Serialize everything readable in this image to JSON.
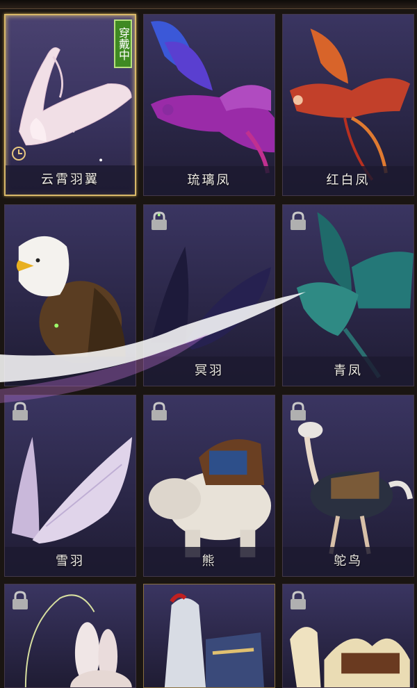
{
  "wear_badge": "穿戴中",
  "mounts": [
    {
      "name": "云霄羽翼",
      "locked": false,
      "selected": true,
      "icon": "white-wings-icon"
    },
    {
      "name": "琉璃凤",
      "locked": false,
      "selected": false,
      "icon": "purple-phoenix-icon"
    },
    {
      "name": "红白凤",
      "locked": false,
      "selected": false,
      "icon": "red-phoenix-icon"
    },
    {
      "name": "",
      "locked": false,
      "selected": false,
      "icon": "eagle-icon"
    },
    {
      "name": "冥羽",
      "locked": true,
      "selected": false,
      "icon": "dark-wings-icon"
    },
    {
      "name": "青凤",
      "locked": true,
      "selected": false,
      "icon": "teal-phoenix-icon"
    },
    {
      "name": "雪羽",
      "locked": true,
      "selected": false,
      "icon": "snow-wings-icon"
    },
    {
      "name": "熊",
      "locked": true,
      "selected": false,
      "icon": "bear-icon"
    },
    {
      "name": "鸵鸟",
      "locked": true,
      "selected": false,
      "icon": "ostrich-icon"
    },
    {
      "name": "",
      "locked": true,
      "selected": false,
      "icon": "rabbit-icon"
    },
    {
      "name": "",
      "locked": false,
      "selected": false,
      "icon": "horse-icon"
    },
    {
      "name": "",
      "locked": true,
      "selected": false,
      "icon": "camel-icon"
    }
  ],
  "colors": {
    "accent_gold": "#d8b86a",
    "badge_green": "#3f8a22",
    "card_bg": "#2b2748"
  }
}
